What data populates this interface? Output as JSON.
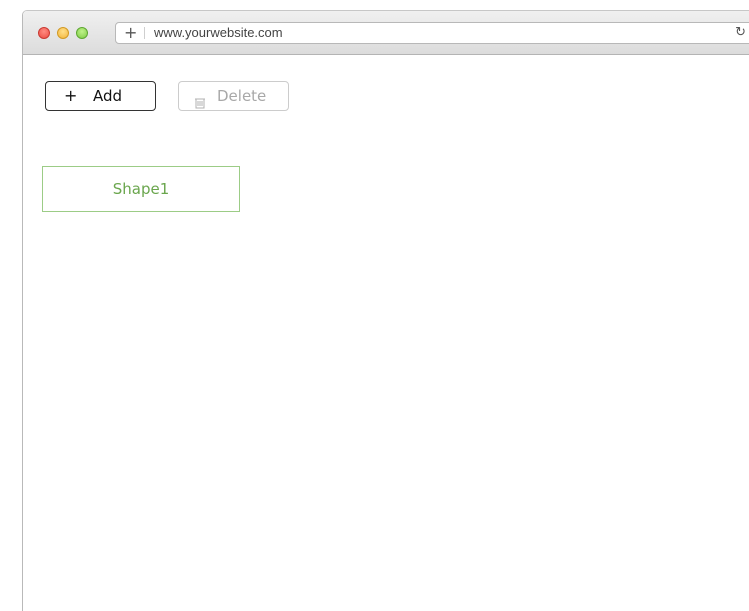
{
  "browser": {
    "url": "www.yourwebsite.com",
    "icons": {
      "new_tab": "plus-icon",
      "reload": "reload-icon"
    }
  },
  "toolbar": {
    "add_label": "Add",
    "delete_label": "Delete",
    "add_icon": "plus-icon",
    "delete_icon": "trash-icon"
  },
  "canvas": {
    "shapes": [
      {
        "label": "Shape1",
        "color": "#6aa64d"
      }
    ]
  }
}
